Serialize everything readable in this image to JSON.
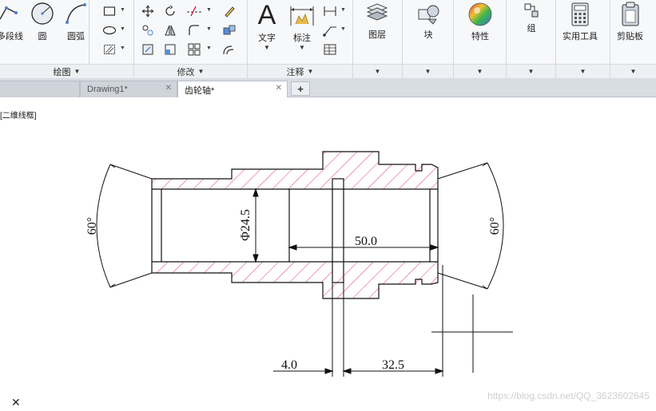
{
  "ribbon": {
    "draw_group": {
      "title": "绘图",
      "polyline_label": "多段线",
      "circle_label": "圆",
      "arc_label": "圆弧"
    },
    "modify_group": {
      "title": "修改"
    },
    "annotate_group": {
      "title": "注释",
      "text_label": "文字",
      "dim_label": "标注"
    },
    "layers_label": "图层",
    "block_label": "块",
    "properties_label": "特性",
    "groups_label": "组",
    "utilities_label": "实用工具",
    "clipboard_label": "剪贴板"
  },
  "tabs": [
    {
      "label": "Drawing1*"
    },
    {
      "label": "齿轮轴*"
    }
  ],
  "canvas": {
    "view_label": "[二维线框]",
    "watermark": "https://blog.csdn.net/QQ_3623602645"
  },
  "drawing": {
    "angle_left": "60°",
    "angle_right": "60°",
    "dim_diameter": "Φ24.5",
    "dim_length_main": "50.0",
    "dim_length_left": "4.0",
    "dim_length_right": "32.5"
  },
  "colors": {
    "hatch": "#e0405a",
    "line": "#111111"
  }
}
